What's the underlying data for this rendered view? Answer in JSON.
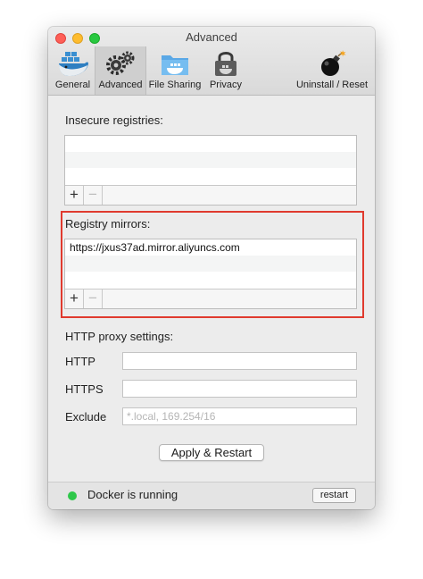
{
  "window": {
    "title": "Advanced"
  },
  "toolbar": {
    "tabs": [
      {
        "label": "General",
        "icon": "docker-whale-icon"
      },
      {
        "label": "Advanced",
        "icon": "gears-icon",
        "selected": true
      },
      {
        "label": "File Sharing",
        "icon": "folder-whale-icon"
      },
      {
        "label": "Privacy",
        "icon": "lock-bag-icon"
      }
    ],
    "uninstall": {
      "label": "Uninstall / Reset",
      "icon": "bomb-icon"
    }
  },
  "insecure_registries": {
    "label": "Insecure registries:",
    "items": []
  },
  "registry_mirrors": {
    "label": "Registry mirrors:",
    "items": [
      "https://jxus37ad.mirror.aliyuncs.com"
    ]
  },
  "list_controls": {
    "add": "+",
    "remove": "−"
  },
  "proxy": {
    "label": "HTTP proxy settings:",
    "http": {
      "label": "HTTP",
      "value": ""
    },
    "https": {
      "label": "HTTPS",
      "value": ""
    },
    "exclude": {
      "label": "Exclude",
      "value": "",
      "placeholder": "*.local, 169.254/16"
    }
  },
  "apply_button": "Apply & Restart",
  "status": {
    "text": "Docker is running",
    "color": "#2ec74a",
    "restart_label": "restart"
  },
  "colors": {
    "highlight": "#e03a2e",
    "close": "#fe5f57",
    "minimize": "#febc2e",
    "maximize": "#28c840"
  }
}
